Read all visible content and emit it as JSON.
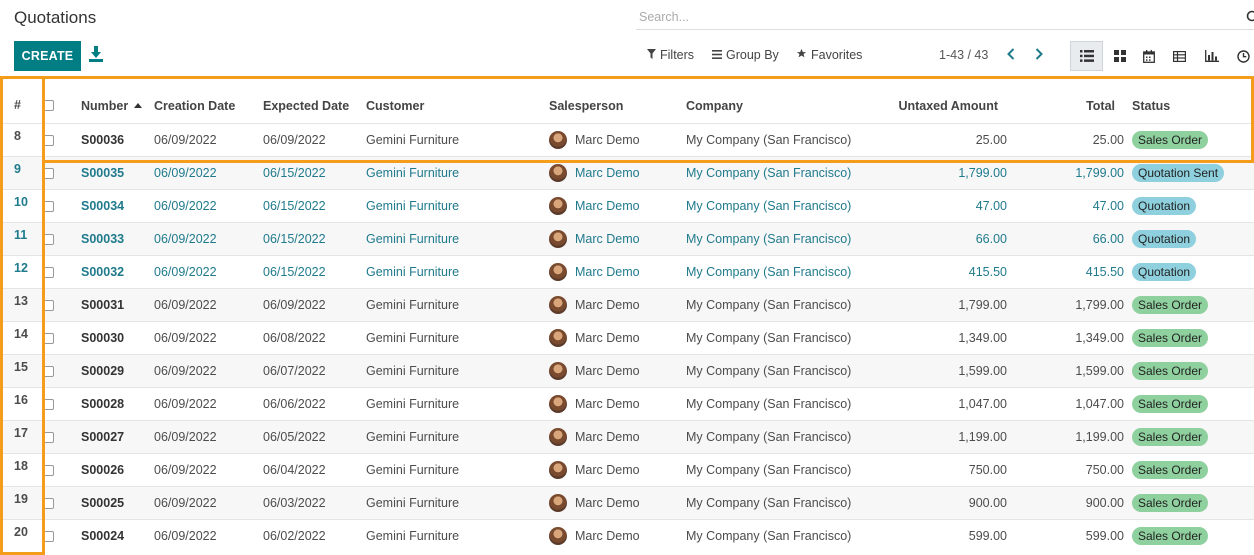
{
  "title": "Quotations",
  "create_label": "CREATE",
  "search_placeholder": "Search...",
  "filters_label": "Filters",
  "group_by_label": "Group By",
  "favorites_label": "Favorites",
  "pager_text": "1-43 / 43",
  "headers": {
    "index": "#",
    "number": "Number",
    "creation_date": "Creation Date",
    "expected_date": "Expected Date",
    "customer": "Customer",
    "salesperson": "Salesperson",
    "company": "Company",
    "untaxed": "Untaxed Amount",
    "total": "Total",
    "status": "Status"
  },
  "colors": {
    "accent": "#017e84",
    "highlight": "#f59c1a",
    "sales_order": "#8fd19e",
    "quotation": "#8ed0de",
    "link": "#1f7a8c"
  },
  "rows": [
    {
      "idx": "8",
      "number": "S00036",
      "created": "06/09/2022",
      "expected": "06/09/2022",
      "customer": "Gemini Furniture",
      "salesperson": "Marc Demo",
      "company": "My Company (San Francisco)",
      "untaxed": "25.00",
      "total": "25.00",
      "status": "Sales Order",
      "kind": "sale"
    },
    {
      "idx": "9",
      "number": "S00035",
      "created": "06/09/2022",
      "expected": "06/15/2022",
      "customer": "Gemini Furniture",
      "salesperson": "Marc Demo",
      "company": "My Company (San Francisco)",
      "untaxed": "1,799.00",
      "total": "1,799.00",
      "status": "Quotation Sent",
      "kind": "quote"
    },
    {
      "idx": "10",
      "number": "S00034",
      "created": "06/09/2022",
      "expected": "06/15/2022",
      "customer": "Gemini Furniture",
      "salesperson": "Marc Demo",
      "company": "My Company (San Francisco)",
      "untaxed": "47.00",
      "total": "47.00",
      "status": "Quotation",
      "kind": "quote"
    },
    {
      "idx": "11",
      "number": "S00033",
      "created": "06/09/2022",
      "expected": "06/15/2022",
      "customer": "Gemini Furniture",
      "salesperson": "Marc Demo",
      "company": "My Company (San Francisco)",
      "untaxed": "66.00",
      "total": "66.00",
      "status": "Quotation",
      "kind": "quote"
    },
    {
      "idx": "12",
      "number": "S00032",
      "created": "06/09/2022",
      "expected": "06/15/2022",
      "customer": "Gemini Furniture",
      "salesperson": "Marc Demo",
      "company": "My Company (San Francisco)",
      "untaxed": "415.50",
      "total": "415.50",
      "status": "Quotation",
      "kind": "quote"
    },
    {
      "idx": "13",
      "number": "S00031",
      "created": "06/09/2022",
      "expected": "06/09/2022",
      "customer": "Gemini Furniture",
      "salesperson": "Marc Demo",
      "company": "My Company (San Francisco)",
      "untaxed": "1,799.00",
      "total": "1,799.00",
      "status": "Sales Order",
      "kind": "sale"
    },
    {
      "idx": "14",
      "number": "S00030",
      "created": "06/09/2022",
      "expected": "06/08/2022",
      "customer": "Gemini Furniture",
      "salesperson": "Marc Demo",
      "company": "My Company (San Francisco)",
      "untaxed": "1,349.00",
      "total": "1,349.00",
      "status": "Sales Order",
      "kind": "sale"
    },
    {
      "idx": "15",
      "number": "S00029",
      "created": "06/09/2022",
      "expected": "06/07/2022",
      "customer": "Gemini Furniture",
      "salesperson": "Marc Demo",
      "company": "My Company (San Francisco)",
      "untaxed": "1,599.00",
      "total": "1,599.00",
      "status": "Sales Order",
      "kind": "sale"
    },
    {
      "idx": "16",
      "number": "S00028",
      "created": "06/09/2022",
      "expected": "06/06/2022",
      "customer": "Gemini Furniture",
      "salesperson": "Marc Demo",
      "company": "My Company (San Francisco)",
      "untaxed": "1,047.00",
      "total": "1,047.00",
      "status": "Sales Order",
      "kind": "sale"
    },
    {
      "idx": "17",
      "number": "S00027",
      "created": "06/09/2022",
      "expected": "06/05/2022",
      "customer": "Gemini Furniture",
      "salesperson": "Marc Demo",
      "company": "My Company (San Francisco)",
      "untaxed": "1,199.00",
      "total": "1,199.00",
      "status": "Sales Order",
      "kind": "sale"
    },
    {
      "idx": "18",
      "number": "S00026",
      "created": "06/09/2022",
      "expected": "06/04/2022",
      "customer": "Gemini Furniture",
      "salesperson": "Marc Demo",
      "company": "My Company (San Francisco)",
      "untaxed": "750.00",
      "total": "750.00",
      "status": "Sales Order",
      "kind": "sale"
    },
    {
      "idx": "19",
      "number": "S00025",
      "created": "06/09/2022",
      "expected": "06/03/2022",
      "customer": "Gemini Furniture",
      "salesperson": "Marc Demo",
      "company": "My Company (San Francisco)",
      "untaxed": "900.00",
      "total": "900.00",
      "status": "Sales Order",
      "kind": "sale"
    },
    {
      "idx": "20",
      "number": "S00024",
      "created": "06/09/2022",
      "expected": "06/02/2022",
      "customer": "Gemini Furniture",
      "salesperson": "Marc Demo",
      "company": "My Company (San Francisco)",
      "untaxed": "599.00",
      "total": "599.00",
      "status": "Sales Order",
      "kind": "sale"
    }
  ]
}
